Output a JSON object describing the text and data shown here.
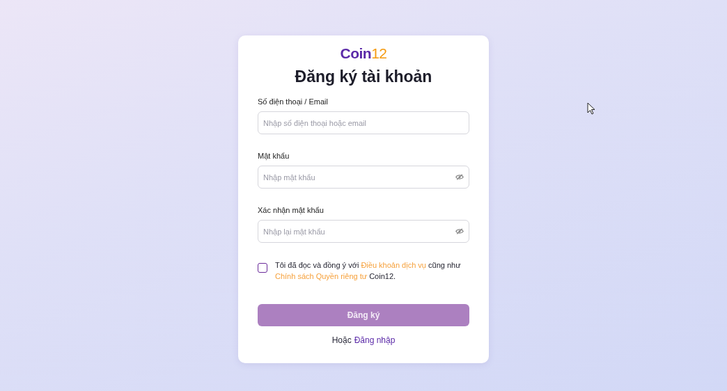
{
  "logo": {
    "main": "Coin",
    "accent": "12"
  },
  "title": "Đăng ký tài khoản",
  "fields": [
    {
      "label": "Số điện thoại / Email",
      "placeholder": "Nhập số điện thoại hoặc email",
      "kind": "text"
    },
    {
      "label": "Mật khẩu",
      "placeholder": "Nhập mật khẩu",
      "kind": "password"
    },
    {
      "label": "Xác nhận mật khẩu",
      "placeholder": "Nhập lại mật khẩu",
      "kind": "password"
    }
  ],
  "agreement": {
    "checked": false,
    "text_before": "Tôi đã đọc và đồng ý với ",
    "terms_link": "Điều khoản dịch vụ",
    "text_middle": " cũng như ",
    "privacy_link": "Chính sách Quyền riêng tư",
    "text_after": " Coin12."
  },
  "submit": {
    "label": "Đăng ký",
    "disabled": true
  },
  "login": {
    "prefix": "Hoặc",
    "link": "Đăng nhập"
  }
}
